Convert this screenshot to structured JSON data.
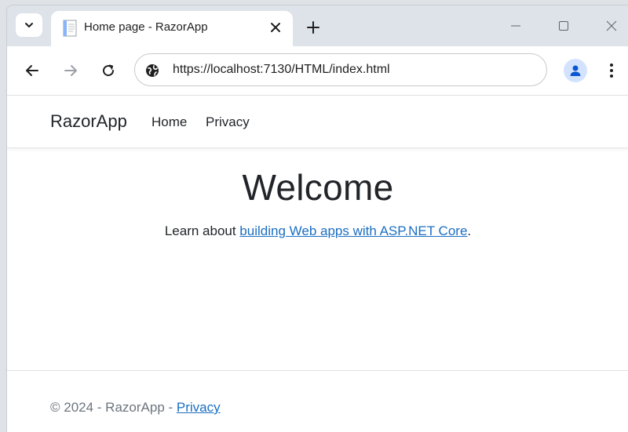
{
  "browser": {
    "tab": {
      "title": "Home page - RazorApp"
    },
    "address_bar": {
      "url": "https://localhost:7130/HTML/index.html"
    }
  },
  "site": {
    "brand": "RazorApp",
    "nav": [
      {
        "label": "Home"
      },
      {
        "label": "Privacy"
      }
    ],
    "heading": "Welcome",
    "lead": {
      "prefix": "Learn about ",
      "link_text": "building Web apps with ASP.NET Core",
      "suffix": "."
    },
    "footer": {
      "prefix": "© 2024 - RazorApp - ",
      "link_text": "Privacy"
    }
  },
  "colors": {
    "link": "#1b6ec2",
    "text": "#212529",
    "muted": "#6c757d",
    "profile_bg": "#d3e3fd",
    "profile_icon": "#0b57d0"
  },
  "icons": {
    "tab_search": "chevron-down-icon",
    "favicon": "document-icon",
    "tab_close": "close-icon",
    "new_tab": "plus-icon",
    "back": "arrow-left-icon",
    "forward": "arrow-right-icon",
    "reload": "reload-icon",
    "site_info": "globe-icon",
    "profile": "person-icon",
    "menu": "kebab-menu-icon"
  }
}
